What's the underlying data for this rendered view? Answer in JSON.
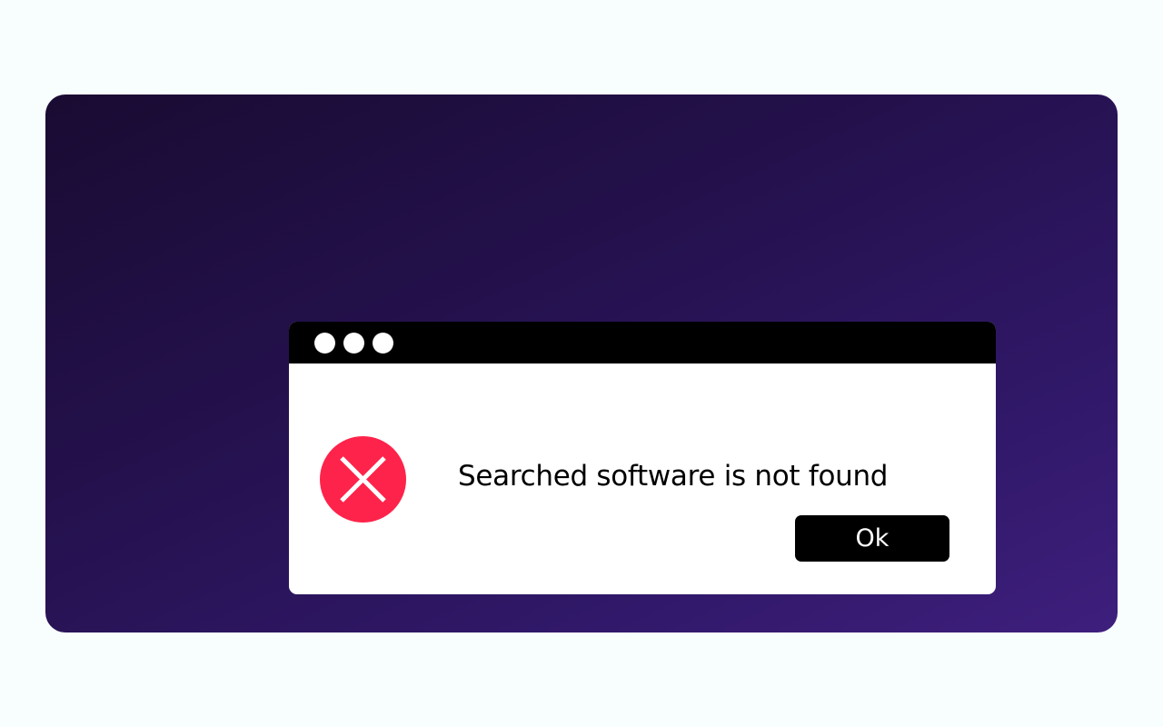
{
  "dialog": {
    "message": "Searched software is not found",
    "ok_label": "Ok",
    "icon": "error-x-icon",
    "window_controls": [
      "dot",
      "dot",
      "dot"
    ]
  },
  "colors": {
    "page_background": "#f8fdfd",
    "stage_gradient_start": "#190b32",
    "stage_gradient_end": "#3e1f7d",
    "titlebar": "#000000",
    "dialog_body": "#ffffff",
    "error_icon": "#fe234a",
    "button": "#000000",
    "button_text": "#ffffff"
  }
}
